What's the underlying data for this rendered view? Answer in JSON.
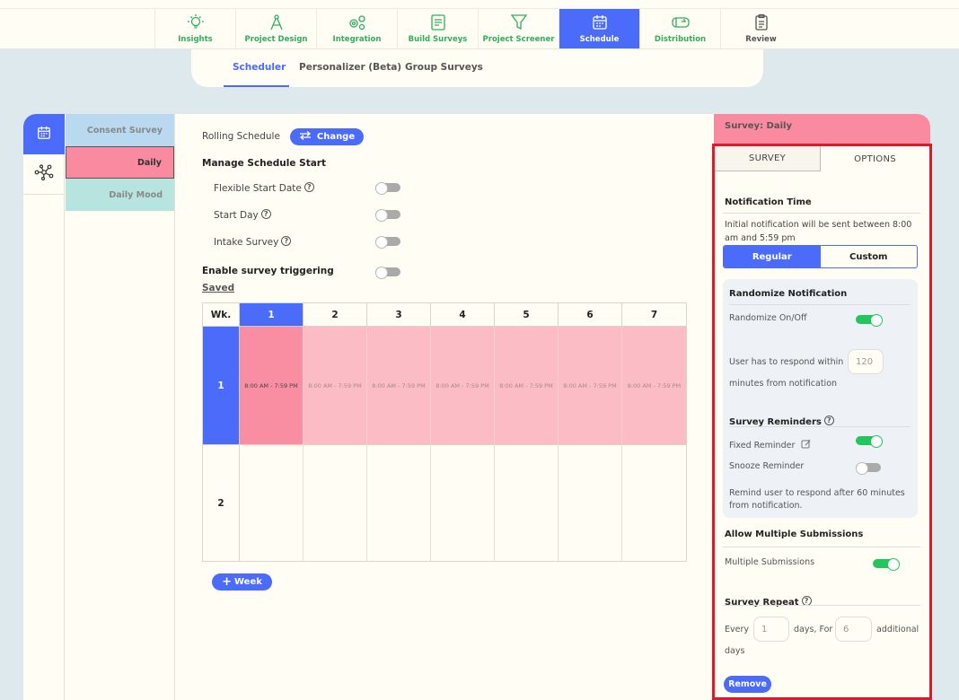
{
  "nav": {
    "items": [
      {
        "label": "Insights",
        "icon": "lightbulb-icon"
      },
      {
        "label": "Project Design",
        "icon": "compass-icon"
      },
      {
        "label": "Integration",
        "icon": "gears-icon"
      },
      {
        "label": "Build Surveys",
        "icon": "document-icon"
      },
      {
        "label": "Project Screener",
        "icon": "filter-icon"
      },
      {
        "label": "Schedule",
        "icon": "calendar-icon",
        "active": true
      },
      {
        "label": "Distribution",
        "icon": "mailbox-icon"
      },
      {
        "label": "Review",
        "icon": "clipboard-icon"
      }
    ]
  },
  "subtabs": {
    "scheduler": "Scheduler",
    "personalizer": "Personalizer (Beta)",
    "group": "Group Surveys"
  },
  "surveys": {
    "consent": "Consent Survey",
    "daily": "Daily",
    "mood": "Daily Mood"
  },
  "schedule": {
    "rolling_label": "Rolling Schedule",
    "change_label": "Change",
    "manage_title": "Manage Schedule Start",
    "flexible_label": "Flexible Start Date",
    "start_day_label": "Start Day",
    "intake_label": "Intake Survey",
    "trigger_label": "Enable survey triggering",
    "saved_label": "Saved",
    "week_btn": "Week",
    "grid": {
      "wk_header": "Wk.",
      "days": [
        "1",
        "2",
        "3",
        "4",
        "5",
        "6",
        "7"
      ],
      "weeks": [
        "1",
        "2"
      ],
      "slot_text": "8:00 AM - 7:59 PM"
    }
  },
  "right_panel": {
    "header": "Survey: Daily",
    "tab_survey": "SURVEY",
    "tab_options": "OPTIONS",
    "notif_title": "Notification Time",
    "notif_desc_1": "Initial notification will be sent between 8:00",
    "notif_desc_2": "am and 5:59 pm",
    "seg_regular": "Regular",
    "seg_custom": "Custom",
    "random_title": "Randomize Notification",
    "random_onoff": "Randomize On/Off",
    "respond_within": "User has to respond within",
    "respond_value": "120",
    "minutes_from": "minutes from notification",
    "reminders_title": "Survey Reminders",
    "fixed_reminder": "Fixed Reminder",
    "snooze_reminder": "Snooze Reminder",
    "remind_desc_1": "Remind user to respond after 60 minutes",
    "remind_desc_2": "from notification.",
    "multi_title": "Allow Multiple Submissions",
    "multi_label": "Multiple Submissions",
    "repeat_title": "Survey Repeat",
    "every": "Every",
    "every_value": "1",
    "days_for": "days, For",
    "for_value": "6",
    "additional": "additional",
    "days": "days",
    "remove": "Remove"
  },
  "colors": {
    "accent": "#4b6bfb",
    "daily": "#fa8aa0",
    "consent": "#b8d9ef",
    "mood": "#b8e4df",
    "highlight": "#e0182d",
    "toggle_on": "#22c55e"
  }
}
